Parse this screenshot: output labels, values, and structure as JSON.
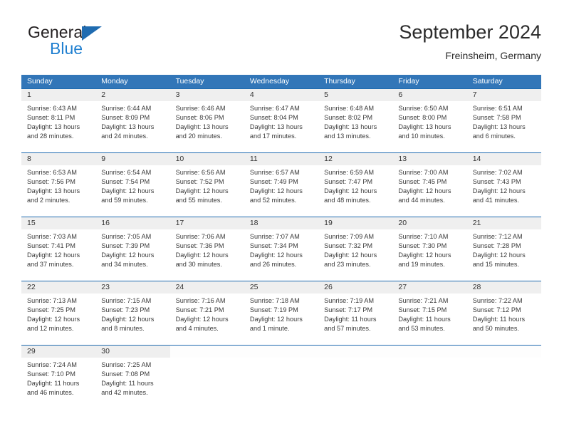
{
  "brand": {
    "name_part1": "General",
    "name_part2": "Blue",
    "logo_icon": "triangle-logo-icon"
  },
  "header": {
    "title": "September 2024",
    "location": "Freinsheim, Germany"
  },
  "colors": {
    "header_blue": "#3276b8",
    "rule_blue": "#1f6bb0",
    "daynum_band": "#efefef",
    "brand_blue": "#1f7fd0",
    "text": "#3a3a3a"
  },
  "weekdays": [
    "Sunday",
    "Monday",
    "Tuesday",
    "Wednesday",
    "Thursday",
    "Friday",
    "Saturday"
  ],
  "weeks": [
    [
      {
        "day": "1",
        "sunrise": "Sunrise: 6:43 AM",
        "sunset": "Sunset: 8:11 PM",
        "daylight1": "Daylight: 13 hours",
        "daylight2": "and 28 minutes."
      },
      {
        "day": "2",
        "sunrise": "Sunrise: 6:44 AM",
        "sunset": "Sunset: 8:09 PM",
        "daylight1": "Daylight: 13 hours",
        "daylight2": "and 24 minutes."
      },
      {
        "day": "3",
        "sunrise": "Sunrise: 6:46 AM",
        "sunset": "Sunset: 8:06 PM",
        "daylight1": "Daylight: 13 hours",
        "daylight2": "and 20 minutes."
      },
      {
        "day": "4",
        "sunrise": "Sunrise: 6:47 AM",
        "sunset": "Sunset: 8:04 PM",
        "daylight1": "Daylight: 13 hours",
        "daylight2": "and 17 minutes."
      },
      {
        "day": "5",
        "sunrise": "Sunrise: 6:48 AM",
        "sunset": "Sunset: 8:02 PM",
        "daylight1": "Daylight: 13 hours",
        "daylight2": "and 13 minutes."
      },
      {
        "day": "6",
        "sunrise": "Sunrise: 6:50 AM",
        "sunset": "Sunset: 8:00 PM",
        "daylight1": "Daylight: 13 hours",
        "daylight2": "and 10 minutes."
      },
      {
        "day": "7",
        "sunrise": "Sunrise: 6:51 AM",
        "sunset": "Sunset: 7:58 PM",
        "daylight1": "Daylight: 13 hours",
        "daylight2": "and 6 minutes."
      }
    ],
    [
      {
        "day": "8",
        "sunrise": "Sunrise: 6:53 AM",
        "sunset": "Sunset: 7:56 PM",
        "daylight1": "Daylight: 13 hours",
        "daylight2": "and 2 minutes."
      },
      {
        "day": "9",
        "sunrise": "Sunrise: 6:54 AM",
        "sunset": "Sunset: 7:54 PM",
        "daylight1": "Daylight: 12 hours",
        "daylight2": "and 59 minutes."
      },
      {
        "day": "10",
        "sunrise": "Sunrise: 6:56 AM",
        "sunset": "Sunset: 7:52 PM",
        "daylight1": "Daylight: 12 hours",
        "daylight2": "and 55 minutes."
      },
      {
        "day": "11",
        "sunrise": "Sunrise: 6:57 AM",
        "sunset": "Sunset: 7:49 PM",
        "daylight1": "Daylight: 12 hours",
        "daylight2": "and 52 minutes."
      },
      {
        "day": "12",
        "sunrise": "Sunrise: 6:59 AM",
        "sunset": "Sunset: 7:47 PM",
        "daylight1": "Daylight: 12 hours",
        "daylight2": "and 48 minutes."
      },
      {
        "day": "13",
        "sunrise": "Sunrise: 7:00 AM",
        "sunset": "Sunset: 7:45 PM",
        "daylight1": "Daylight: 12 hours",
        "daylight2": "and 44 minutes."
      },
      {
        "day": "14",
        "sunrise": "Sunrise: 7:02 AM",
        "sunset": "Sunset: 7:43 PM",
        "daylight1": "Daylight: 12 hours",
        "daylight2": "and 41 minutes."
      }
    ],
    [
      {
        "day": "15",
        "sunrise": "Sunrise: 7:03 AM",
        "sunset": "Sunset: 7:41 PM",
        "daylight1": "Daylight: 12 hours",
        "daylight2": "and 37 minutes."
      },
      {
        "day": "16",
        "sunrise": "Sunrise: 7:05 AM",
        "sunset": "Sunset: 7:39 PM",
        "daylight1": "Daylight: 12 hours",
        "daylight2": "and 34 minutes."
      },
      {
        "day": "17",
        "sunrise": "Sunrise: 7:06 AM",
        "sunset": "Sunset: 7:36 PM",
        "daylight1": "Daylight: 12 hours",
        "daylight2": "and 30 minutes."
      },
      {
        "day": "18",
        "sunrise": "Sunrise: 7:07 AM",
        "sunset": "Sunset: 7:34 PM",
        "daylight1": "Daylight: 12 hours",
        "daylight2": "and 26 minutes."
      },
      {
        "day": "19",
        "sunrise": "Sunrise: 7:09 AM",
        "sunset": "Sunset: 7:32 PM",
        "daylight1": "Daylight: 12 hours",
        "daylight2": "and 23 minutes."
      },
      {
        "day": "20",
        "sunrise": "Sunrise: 7:10 AM",
        "sunset": "Sunset: 7:30 PM",
        "daylight1": "Daylight: 12 hours",
        "daylight2": "and 19 minutes."
      },
      {
        "day": "21",
        "sunrise": "Sunrise: 7:12 AM",
        "sunset": "Sunset: 7:28 PM",
        "daylight1": "Daylight: 12 hours",
        "daylight2": "and 15 minutes."
      }
    ],
    [
      {
        "day": "22",
        "sunrise": "Sunrise: 7:13 AM",
        "sunset": "Sunset: 7:25 PM",
        "daylight1": "Daylight: 12 hours",
        "daylight2": "and 12 minutes."
      },
      {
        "day": "23",
        "sunrise": "Sunrise: 7:15 AM",
        "sunset": "Sunset: 7:23 PM",
        "daylight1": "Daylight: 12 hours",
        "daylight2": "and 8 minutes."
      },
      {
        "day": "24",
        "sunrise": "Sunrise: 7:16 AM",
        "sunset": "Sunset: 7:21 PM",
        "daylight1": "Daylight: 12 hours",
        "daylight2": "and 4 minutes."
      },
      {
        "day": "25",
        "sunrise": "Sunrise: 7:18 AM",
        "sunset": "Sunset: 7:19 PM",
        "daylight1": "Daylight: 12 hours",
        "daylight2": "and 1 minute."
      },
      {
        "day": "26",
        "sunrise": "Sunrise: 7:19 AM",
        "sunset": "Sunset: 7:17 PM",
        "daylight1": "Daylight: 11 hours",
        "daylight2": "and 57 minutes."
      },
      {
        "day": "27",
        "sunrise": "Sunrise: 7:21 AM",
        "sunset": "Sunset: 7:15 PM",
        "daylight1": "Daylight: 11 hours",
        "daylight2": "and 53 minutes."
      },
      {
        "day": "28",
        "sunrise": "Sunrise: 7:22 AM",
        "sunset": "Sunset: 7:12 PM",
        "daylight1": "Daylight: 11 hours",
        "daylight2": "and 50 minutes."
      }
    ],
    [
      {
        "day": "29",
        "sunrise": "Sunrise: 7:24 AM",
        "sunset": "Sunset: 7:10 PM",
        "daylight1": "Daylight: 11 hours",
        "daylight2": "and 46 minutes."
      },
      {
        "day": "30",
        "sunrise": "Sunrise: 7:25 AM",
        "sunset": "Sunset: 7:08 PM",
        "daylight1": "Daylight: 11 hours",
        "daylight2": "and 42 minutes."
      },
      {
        "day": "",
        "sunrise": "",
        "sunset": "",
        "daylight1": "",
        "daylight2": ""
      },
      {
        "day": "",
        "sunrise": "",
        "sunset": "",
        "daylight1": "",
        "daylight2": ""
      },
      {
        "day": "",
        "sunrise": "",
        "sunset": "",
        "daylight1": "",
        "daylight2": ""
      },
      {
        "day": "",
        "sunrise": "",
        "sunset": "",
        "daylight1": "",
        "daylight2": ""
      },
      {
        "day": "",
        "sunrise": "",
        "sunset": "",
        "daylight1": "",
        "daylight2": ""
      }
    ]
  ]
}
